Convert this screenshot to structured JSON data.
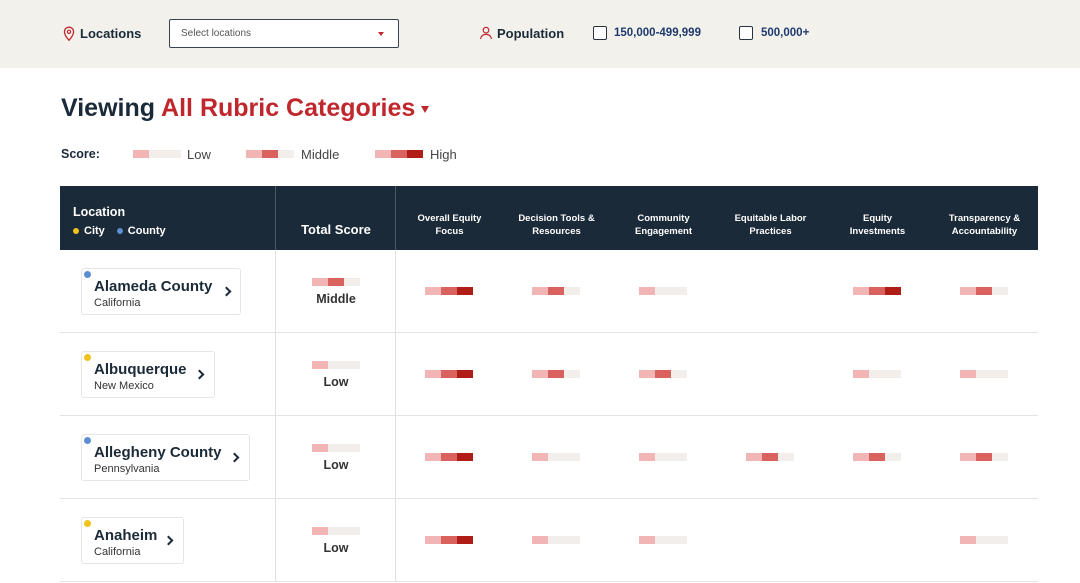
{
  "filters": {
    "locations_label": "Locations",
    "locations_placeholder": "Select locations",
    "population_label": "Population",
    "population_options": [
      "150,000-499,999",
      "500,000+"
    ]
  },
  "heading": {
    "prefix": "Viewing",
    "category": "All Rubric Categories"
  },
  "legend": {
    "title": "Score:",
    "items": [
      {
        "label": "Low",
        "level": 1
      },
      {
        "label": "Middle",
        "level": 2
      },
      {
        "label": "High",
        "level": 3
      }
    ]
  },
  "table": {
    "location_header": "Location",
    "key_city": "City",
    "key_county": "County",
    "total_header": "Total Score",
    "categories": [
      [
        "Overall Equity",
        "Focus"
      ],
      [
        "Decision Tools &",
        "Resources"
      ],
      [
        "Community",
        "Engagement"
      ],
      [
        "Equitable Labor",
        "Practices"
      ],
      [
        "Equity",
        "Investments"
      ],
      [
        "Transparency &",
        "Accountability"
      ]
    ],
    "rows": [
      {
        "name": "Alameda County",
        "state": "California",
        "type": "county",
        "total_label": "Middle",
        "total_level": 2,
        "scores": [
          3,
          2,
          1,
          0,
          3,
          2
        ]
      },
      {
        "name": "Albuquerque",
        "state": "New Mexico",
        "type": "city",
        "total_label": "Low",
        "total_level": 1,
        "scores": [
          3,
          2,
          2,
          0,
          1,
          1
        ]
      },
      {
        "name": "Allegheny County",
        "state": "Pennsylvania",
        "type": "county",
        "total_label": "Low",
        "total_level": 1,
        "scores": [
          3,
          1,
          1,
          2,
          2,
          2
        ]
      },
      {
        "name": "Anaheim",
        "state": "California",
        "type": "city",
        "total_label": "Low",
        "total_level": 1,
        "scores": [
          3,
          1,
          1,
          0,
          0,
          1
        ]
      }
    ]
  },
  "colors": {
    "accent": "#c0272d",
    "header_bg": "#1b2a38",
    "city_dot": "#f0c21b",
    "county_dot": "#5b8fd1",
    "score_low": "#f2b5b5",
    "score_mid": "#d9625f",
    "score_high": "#b01d17",
    "score_empty": "#f1eeeb"
  }
}
